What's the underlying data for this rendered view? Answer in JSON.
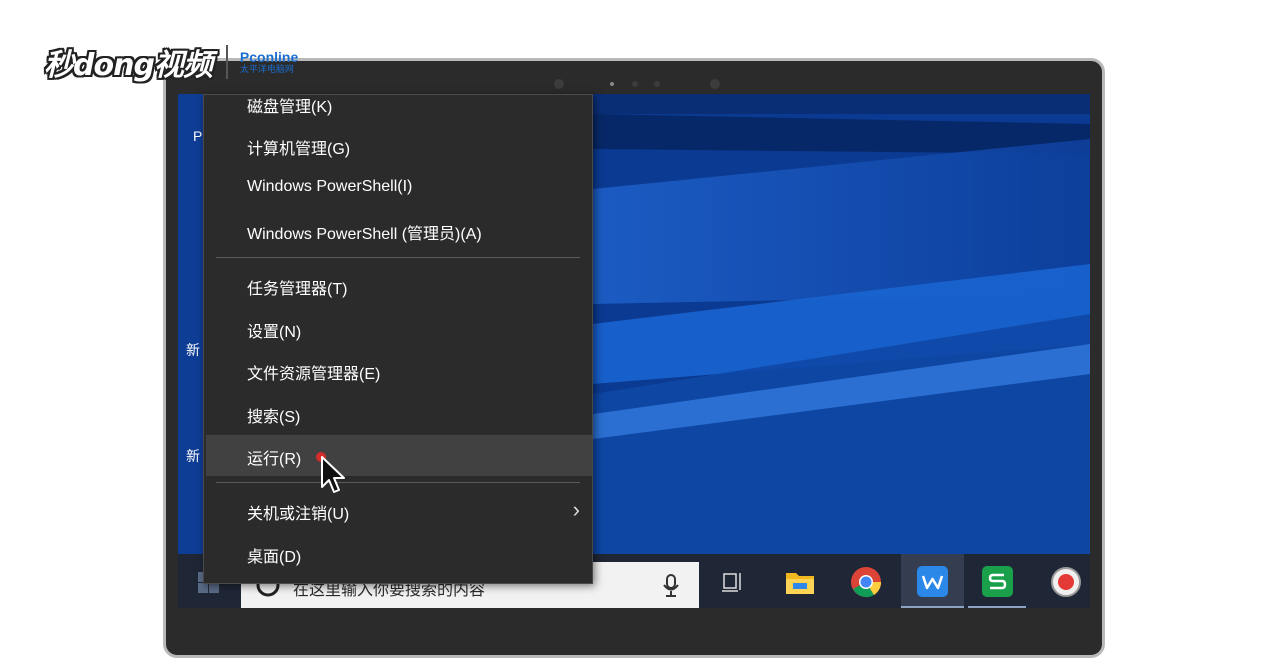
{
  "watermark": {
    "brand": "秒dong视频",
    "pc_brand": "Pconline",
    "pc_sub": "太平洋电脑网"
  },
  "desktop": {
    "label_1": "P",
    "label_2": "新",
    "label_3": "新"
  },
  "context_menu": {
    "items": [
      {
        "label": "磁盘管理(K)"
      },
      {
        "label": "计算机管理(G)"
      },
      {
        "label": "Windows PowerShell(I)"
      },
      {
        "label": "Windows PowerShell (管理员)(A)"
      },
      {
        "label": "任务管理器(T)"
      },
      {
        "label": "设置(N)"
      },
      {
        "label": "文件资源管理器(E)"
      },
      {
        "label": "搜索(S)"
      },
      {
        "label": "运行(R)"
      },
      {
        "label": "关机或注销(U)"
      },
      {
        "label": "桌面(D)"
      }
    ],
    "highlighted": "运行(R)",
    "submenu_chevron": "›"
  },
  "taskbar": {
    "search_placeholder": "在这里输入你要搜索的内容",
    "icons": [
      "start-icon",
      "search-circle-icon",
      "microphone-icon",
      "task-view-icon",
      "file-explorer-icon",
      "chrome-icon",
      "wps-writer-icon",
      "wps-sheets-icon",
      "record-icon"
    ],
    "colors": {
      "taskbar_bg": "#1f2737",
      "wps_writer": "#2b87e8",
      "wps_sheets": "#1aa04a",
      "record": "#e53935"
    }
  }
}
